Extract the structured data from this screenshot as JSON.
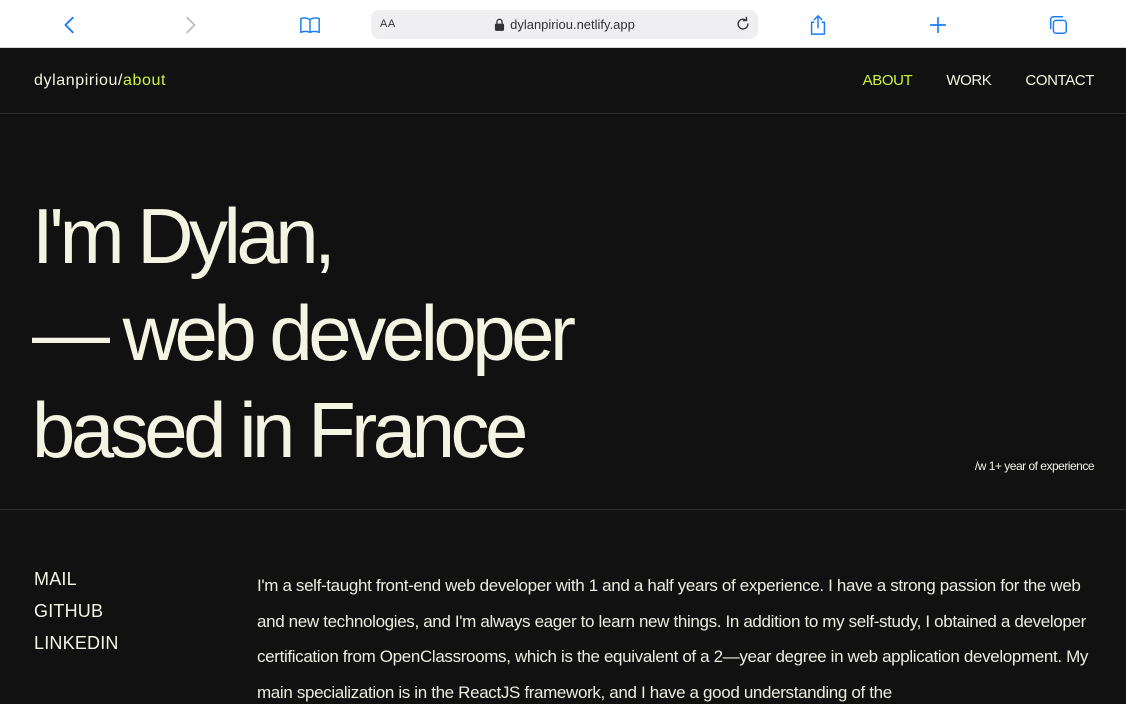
{
  "browser": {
    "reader_label": "AA",
    "url": "dylanpiriou.netlify.app"
  },
  "site": {
    "logo_main": "dylanpiriou/",
    "logo_accent": "about",
    "nav": [
      {
        "label": "ABOUT",
        "active": true
      },
      {
        "label": "WORK",
        "active": false
      },
      {
        "label": "CONTACT",
        "active": false
      }
    ]
  },
  "hero": {
    "line1": "I'm Dylan,",
    "line2": "— web developer",
    "line3": "based in France",
    "experience": "/w 1+ year of experience"
  },
  "links": [
    "MAIL",
    "GITHUB",
    "LINKEDIN"
  ],
  "bio": "I'm a self-taught front-end web developer with 1 and a half years of experience. I have a strong passion for the web and new technologies, and I'm always eager to learn new things. In addition to my self-study, I obtained a developer certification from OpenClassrooms, which is the equivalent of a 2—year degree in web application development. My main specialization is in the ReactJS framework, and I have a good understanding of the",
  "colors": {
    "accent": "#cdf23f",
    "background": "#111111",
    "text": "#f3f4e2",
    "toolbar_icon": "#1a7cf5"
  }
}
